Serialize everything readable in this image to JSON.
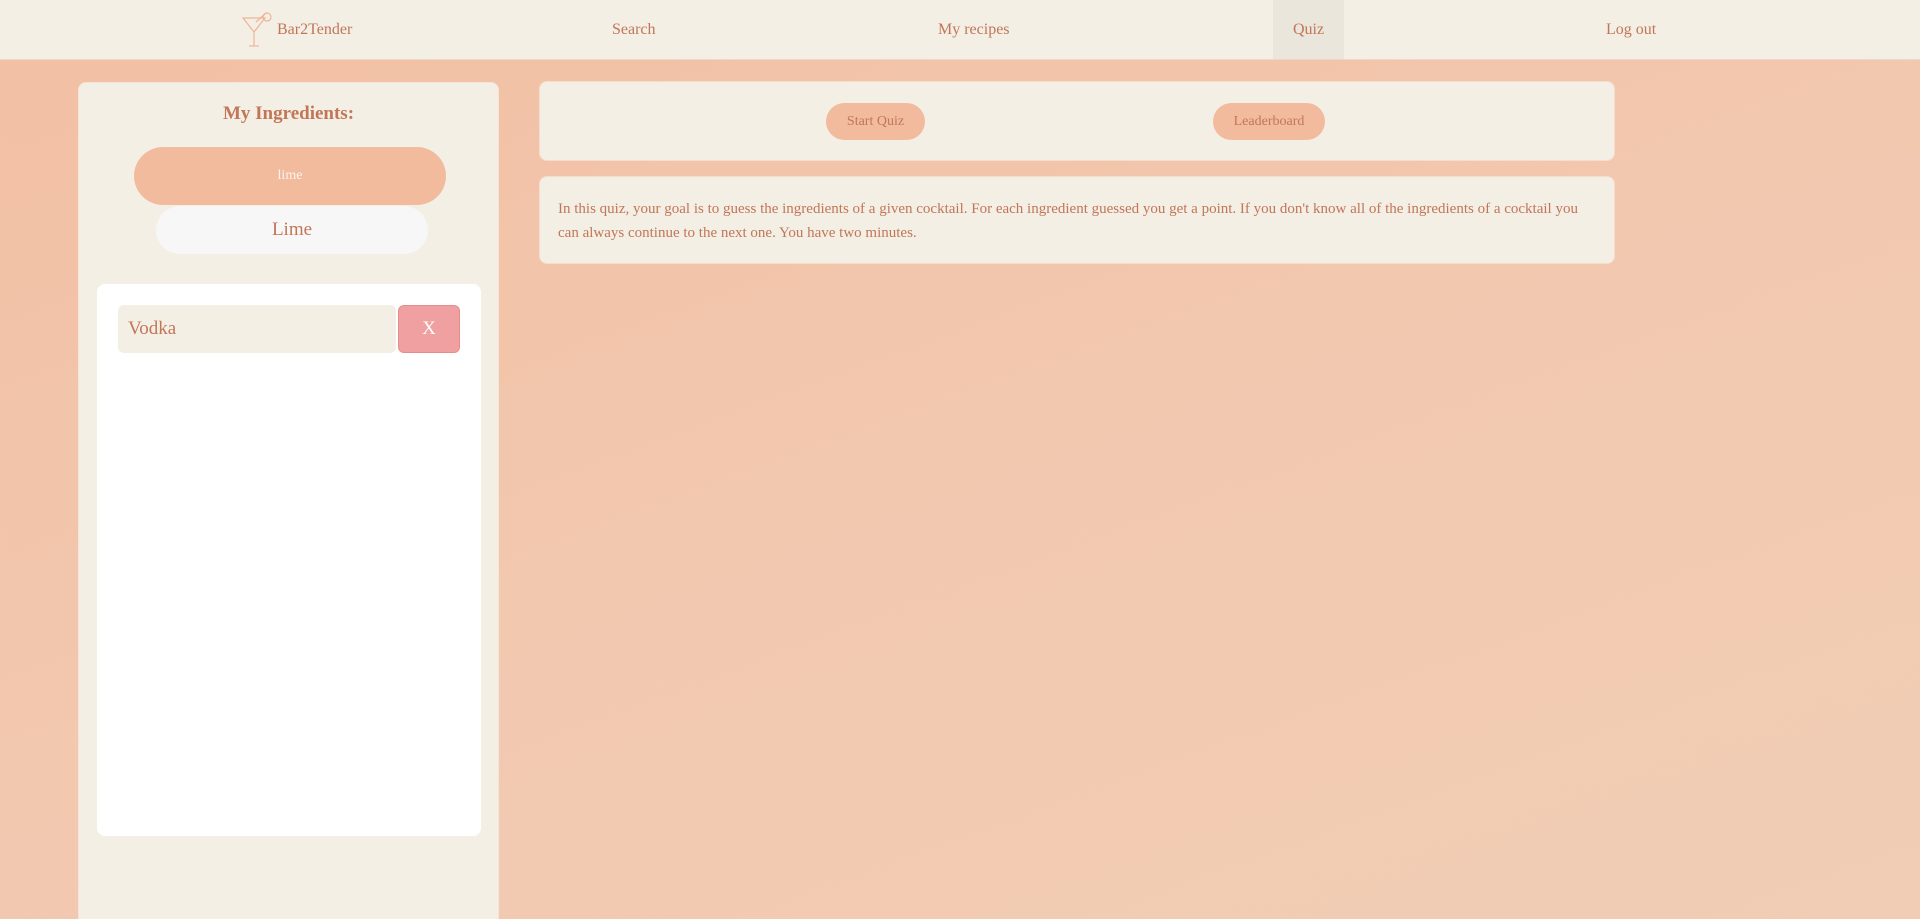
{
  "navbar": {
    "brand_label": "Bar2Tender",
    "brand_icon": "cocktail-glass-icon",
    "search_label": "Search",
    "recipes_label": "My recipes",
    "quiz_label": "Quiz",
    "logout_label": "Log out",
    "active_item": "Quiz"
  },
  "sidebar": {
    "title": "My Ingredients:",
    "input_value": "lime",
    "suggestion": "Lime",
    "ingredients": [
      {
        "name": "Vodka",
        "remove_label": "X"
      }
    ]
  },
  "quiz": {
    "start_label": "Start Quiz",
    "leaderboard_label": "Leaderboard",
    "description": "In this quiz, your goal is to guess the ingredients of a given cocktail. For each ingredient guessed you get a point. If you don't know all of the ingredients of a cocktail you can always continue to the next one. You have two minutes."
  },
  "colors": {
    "background": "#f2c4aa",
    "panel": "#f3efe5",
    "accent": "#f2bb9e",
    "text": "#c27658",
    "remove": "#f0a0a0"
  }
}
